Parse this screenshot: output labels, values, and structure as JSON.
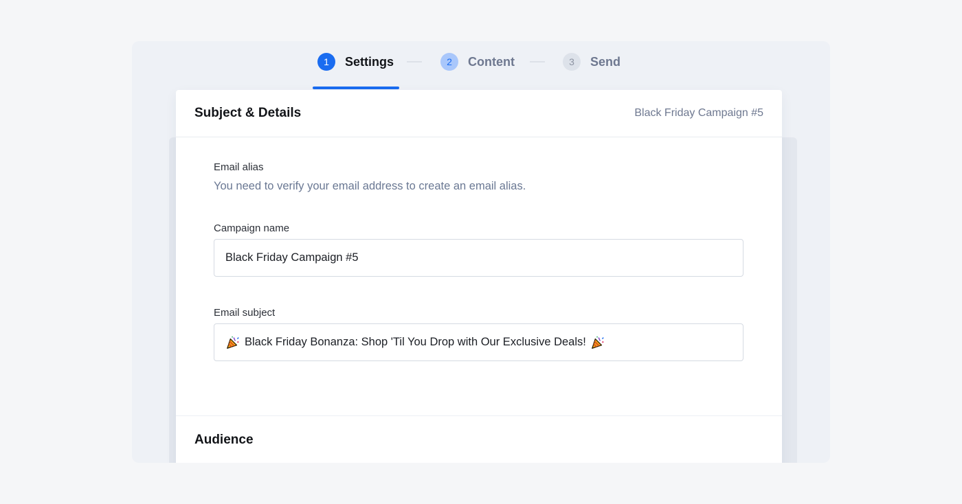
{
  "stepper": {
    "steps": [
      {
        "number": "1",
        "label": "Settings",
        "state": "active"
      },
      {
        "number": "2",
        "label": "Content",
        "state": "next"
      },
      {
        "number": "3",
        "label": "Send",
        "state": "future"
      }
    ]
  },
  "card": {
    "title": "Subject & Details",
    "campaign_label": "Black Friday Campaign #5"
  },
  "email_alias": {
    "label": "Email alias",
    "note": "You need to verify your email address to create an email alias."
  },
  "campaign_name": {
    "label": "Campaign name",
    "value": "Black Friday Campaign #5"
  },
  "email_subject": {
    "label": "Email subject",
    "value": "Black Friday Bonanza: Shop 'Til You Drop with Our Exclusive Deals!",
    "emoji_icon": "party-popper-icon"
  },
  "audience": {
    "title": "Audience"
  },
  "colors": {
    "accent": "#1a6cf0",
    "muted_text": "#6e7890"
  }
}
